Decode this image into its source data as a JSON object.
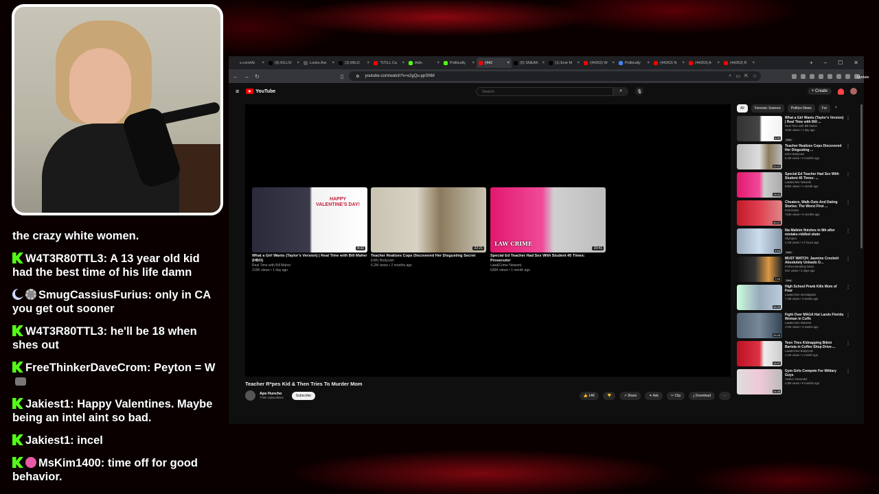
{
  "chat": [
    {
      "badges": [],
      "user": "",
      "text": "the crazy white women.",
      "emote": false
    },
    {
      "badges": [
        "kick"
      ],
      "user": "W4T3R80TTL3:",
      "text": "A 13 year old kid had the best time of his life damn",
      "emote": false
    },
    {
      "badges": [
        "moon",
        "gear"
      ],
      "user": "SmugCassiusFurius:",
      "text": "only in CA you get out sooner",
      "emote": false
    },
    {
      "badges": [
        "kick"
      ],
      "user": "W4T3R80TTL3:",
      "text": "he'll be 18 when shes out",
      "emote": false
    },
    {
      "badges": [
        "kick"
      ],
      "user": "FreeThinkerDaveCrom:",
      "text": "Peyton = W",
      "emote": true
    },
    {
      "badges": [
        "kick"
      ],
      "user": "Jakiest1:",
      "text": "Happy Valentines. Maybe being an intel aint so bad.",
      "emote": false
    },
    {
      "badges": [
        "kick"
      ],
      "user": "Jakiest1:",
      "text": "incel",
      "emote": false
    },
    {
      "badges": [
        "kick",
        "pink"
      ],
      "user": "MsKim1400:",
      "text": "time off for good behavior.",
      "emote": false
    }
  ],
  "browser": {
    "tabs": [
      {
        "label": "x.com/i/b",
        "color": "#222",
        "active": false
      },
      {
        "label": "(6) KILLS!",
        "color": "#000",
        "active": false
      },
      {
        "label": "Looks Are",
        "color": "#555",
        "active": false
      },
      {
        "label": "(3) MILO",
        "color": "#000",
        "active": false
      },
      {
        "label": "\"STILL Ca",
        "color": "#f00",
        "active": false
      },
      {
        "label": "Adin",
        "color": "#53fc18",
        "active": false
      },
      {
        "label": "Politically",
        "color": "#53fc18",
        "active": false
      },
      {
        "label": "(442",
        "color": "#f00",
        "active": true
      },
      {
        "label": "(5) SNEAK",
        "color": "#000",
        "active": false
      },
      {
        "label": "(1) Evie M",
        "color": "#000",
        "active": false
      },
      {
        "label": "(44263) W",
        "color": "#f00",
        "active": false
      },
      {
        "label": "Politically",
        "color": "#4285f4",
        "active": false
      },
      {
        "label": "(44263) N",
        "color": "#f00",
        "active": false
      },
      {
        "label": "(44263) A",
        "color": "#f00",
        "active": false
      },
      {
        "label": "(44263) R",
        "color": "#f00",
        "active": false
      }
    ],
    "url": "youtube.com/watch?v=x2gQu-ppSNM",
    "update_label": "Update"
  },
  "youtube": {
    "logo": "YouTube",
    "search_placeholder": "Search",
    "create_label": "Create",
    "endcards": [
      {
        "title": "What a Girl Wants (Taylor's Version) | Real Time with Bill Maher (HBO)",
        "channel": "Real Time with Bill Maher",
        "meta": "319K views • 1 day ago",
        "duration": "8:32",
        "thumb": "linear-gradient(90deg,#2a2a3a 0%,#3a3a4a 50%,#f2f2f2 52%,#fff 100%)",
        "thumb_text": "HAPPY VALENTINE'S DAY!"
      },
      {
        "title": "Teacher Realizes Cops Discovered Her Disgusting Secret",
        "channel": "EWU Bodycam",
        "meta": "6.2M views • 2 months ago",
        "duration": "22:21",
        "thumb": "linear-gradient(90deg,#c9c3b2 0%,#d8d2c4 40%,#8c7a5c 60%,#c9c3b2 100%)",
        "thumb_text": ""
      },
      {
        "title": "Special Ed Teacher Had Sex With Student 45 Times: Prosecutor",
        "channel": "Law&Crime Network",
        "meta": "636K views • 1 month ago",
        "duration": "19:41",
        "thumb": "linear-gradient(90deg,#e2186e 0%,#f04a9a 45%,#d0d0d0 55%,#bdbdbd 100%)",
        "thumb_text": "LAW CRIME"
      }
    ],
    "video_title": "Teacher R*pes Kid & Then Tries To Murder Mom",
    "channel_name": "Ape Huncho",
    "channel_subs": "779K subscribers",
    "subscribe_label": "Subscribe",
    "likes": "14K",
    "action_share": "Share",
    "action_ask": "Ask",
    "action_clip": "Clip",
    "action_download": "Download",
    "chips": [
      {
        "label": "All",
        "active": true
      },
      {
        "label": "Forensic Science",
        "active": false
      },
      {
        "label": "Politics News",
        "active": false
      },
      {
        "label": "For",
        "active": false
      }
    ],
    "recommendations": [
      {
        "title": "What a Girl Wants (Taylor's Version) | Real Time with Bill ...",
        "channel": "Real Time with Bill Maher",
        "meta": "319K views • 1 day ago",
        "duration": "8:32",
        "new": true,
        "thumb": "linear-gradient(90deg,#333 0%,#444 50%,#fff 55%,#f2f2f2 100%)"
      },
      {
        "title": "Teacher Realizes Cops Discovered Her Disgusting ...",
        "channel": "EWU Bodycam",
        "meta": "6.2M views • 2 months ago",
        "duration": "22:21",
        "new": false,
        "thumb": "linear-gradient(90deg,#bbb 0%,#ddd 50%,#8c7a5c 70%,#bbb 100%)"
      },
      {
        "title": "Special Ed Teacher Had Sex With Student 45 Times: ...",
        "channel": "Law&Crime Network",
        "meta": "636K views • 1 month ago",
        "duration": "19:41",
        "new": false,
        "thumb": "linear-gradient(90deg,#e2186e 0%,#f04a9a 50%,#ccc 60%,#aaa 100%)"
      },
      {
        "title": "Cheaters, Walk-Outs And Dating Stories: The Worst First ...",
        "channel": "First Dates",
        "meta": "716K views • 5 months ago",
        "duration": "40:27",
        "new": false,
        "thumb": "linear-gradient(90deg,#c21a2a 0%,#e04050 50%,#d88 100%)"
      },
      {
        "title": "Ilia Malinin finishes in 8th after mistake-riddled skate",
        "channel": "Olympics",
        "meta": "2.1M views • 17 hours ago",
        "duration": "6:53",
        "new": true,
        "thumb": "linear-gradient(90deg,#9ab 0%,#cde 50%,#89a 100%)"
      },
      {
        "title": "MUST WATCH: Jasmine Crockett Absolutely Unloads O...",
        "channel": "Forbes Breaking News",
        "meta": "91K views • 3 days ago",
        "duration": "7:25",
        "new": true,
        "thumb": "linear-gradient(90deg,#111 0%,#333 40%,#d94 70%,#222 100%)"
      },
      {
        "title": "High School Prank Kills Mom of Four",
        "channel": "Law&Crime Investigates",
        "meta": "7.2M views • 3 weeks ago",
        "duration": "36:05",
        "new": false,
        "thumb": "linear-gradient(90deg,#cfd 0%,#9ab 50%,#bcd 100%)"
      },
      {
        "title": "Fight Over MAGA Hat Lands Florida Woman in Cuffs",
        "channel": "Law&Crime Network",
        "meta": "174K views • 2 weeks ago",
        "duration": "25:08",
        "new": false,
        "thumb": "linear-gradient(90deg,#567 0%,#789 50%,#345 100%)"
      },
      {
        "title": "Teen Tries Kidnapping Bikini Barista in Coffee Shop Drive-...",
        "channel": "Law&Crime BodyCam",
        "meta": "1.1M views • 1 month ago",
        "duration": "19:37",
        "new": false,
        "thumb": "linear-gradient(90deg,#b12 0%,#d34 50%,#eee 60%,#ccc 100%)"
      },
      {
        "title": "Gym Girls Compete For Military Guys",
        "channel": "Austen Alexander",
        "meta": "4.8M views • 8 months ago",
        "duration": "24:38",
        "new": false,
        "thumb": "linear-gradient(90deg,#ddd 0%,#f0c8d8 50%,#bbb 100%)"
      }
    ]
  }
}
